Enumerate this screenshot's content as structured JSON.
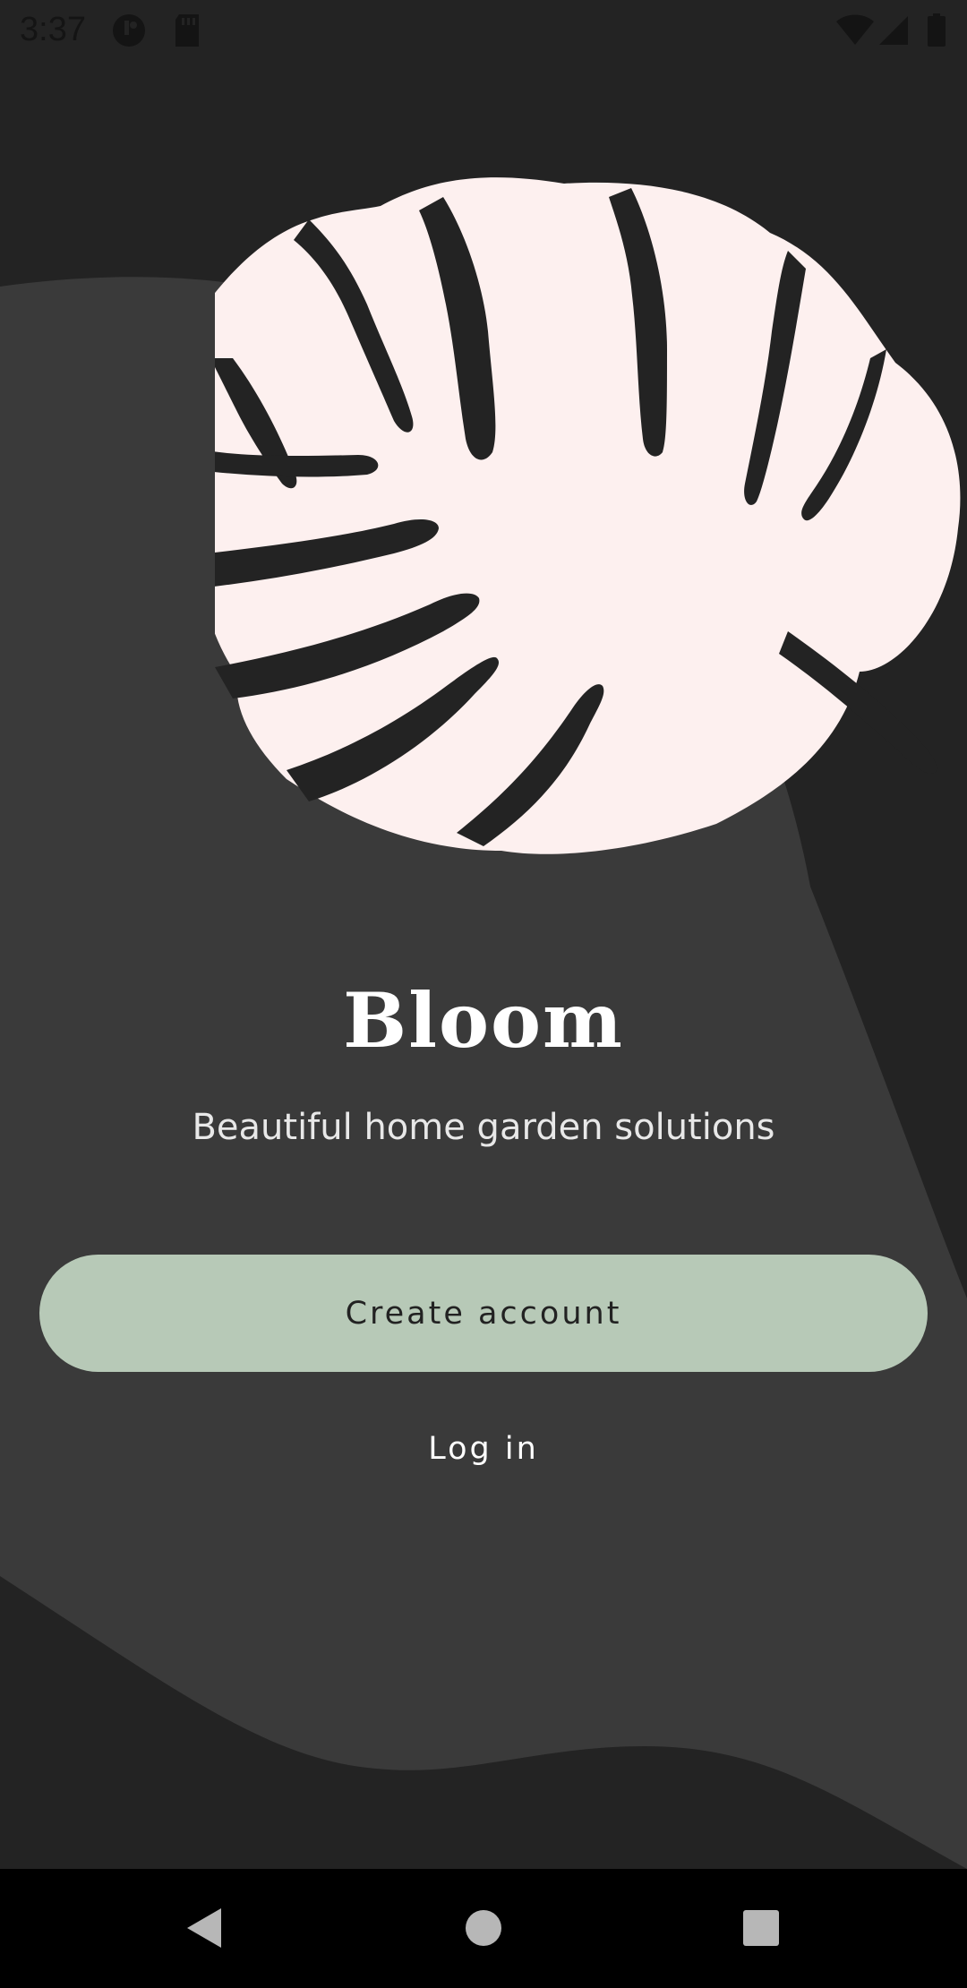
{
  "status_bar": {
    "time": "3:37",
    "icons": [
      "notification-app-icon",
      "sd-card-icon",
      "wifi-icon",
      "signal-icon",
      "battery-icon"
    ]
  },
  "hero": {
    "icon": "monstera-leaf-icon",
    "leaf_color": "#fdf0ef"
  },
  "app": {
    "title": "Bloom",
    "subtitle": "Beautiful home garden solutions"
  },
  "actions": {
    "create_account_label": "Create account",
    "login_label": "Log in",
    "primary_color": "#b7c9b7"
  },
  "colors": {
    "background_dark": "#232323",
    "background_shape": "#3a3a3a",
    "text_on_dark": "#ffffff"
  },
  "navigation": {
    "buttons": [
      "back-icon",
      "home-icon",
      "recents-icon"
    ]
  }
}
